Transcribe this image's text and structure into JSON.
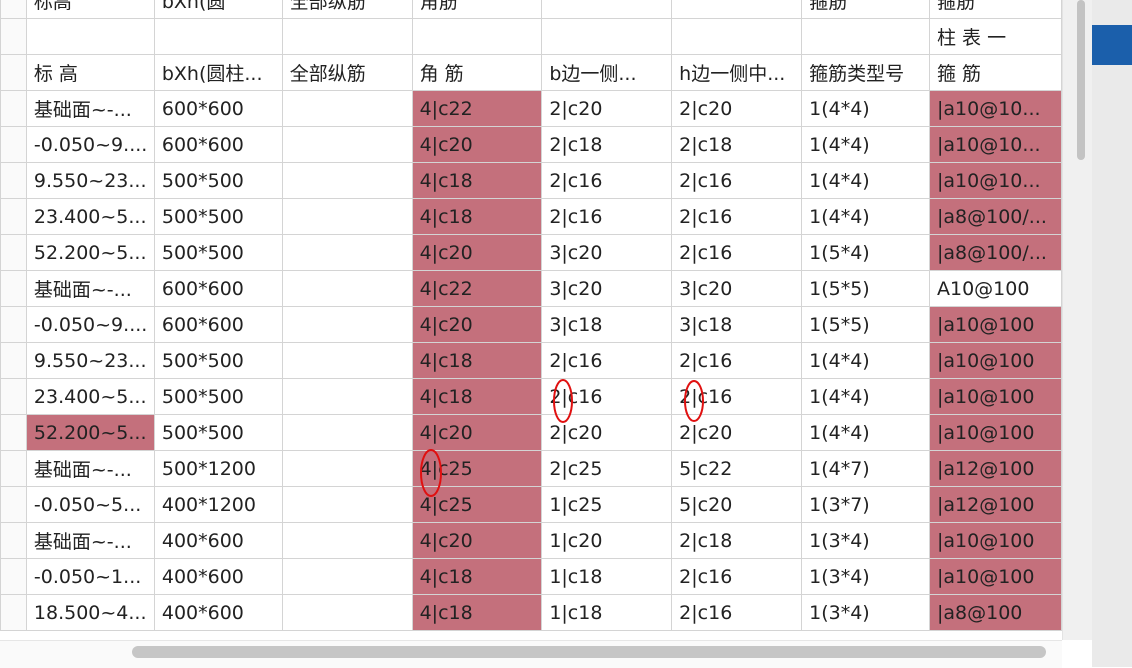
{
  "top_partial": [
    "标高",
    "bXh(圆",
    "全部纵筋",
    "角筋",
    "",
    "",
    "箍筋",
    "箍筋"
  ],
  "header_sub": [
    "",
    "",
    "",
    "",
    "",
    "",
    "",
    "柱 表 一"
  ],
  "headers": [
    "标  高",
    "bXh(圆柱...",
    "全部纵筋",
    "角 筋",
    "b边一侧...",
    "h边一侧中...",
    "箍筋类型号",
    "箍 筋"
  ],
  "rows": [
    {
      "cells": [
        "基础面~-...",
        "600*600",
        "",
        "4|c22",
        "2|c20",
        "2|c20",
        "1(4*4)",
        "|a10@10..."
      ],
      "hl": [
        3,
        7
      ]
    },
    {
      "cells": [
        "-0.050~9....",
        "600*600",
        "",
        "4|c20",
        "2|c18",
        "2|c18",
        "1(4*4)",
        "|a10@10..."
      ],
      "hl": [
        3,
        7
      ]
    },
    {
      "cells": [
        "9.550~23...",
        "500*500",
        "",
        "4|c18",
        "2|c16",
        "2|c16",
        "1(4*4)",
        "|a10@10..."
      ],
      "hl": [
        3,
        7
      ]
    },
    {
      "cells": [
        "23.400~5...",
        "500*500",
        "",
        "4|c18",
        "2|c16",
        "2|c16",
        "1(4*4)",
        "|a8@100/..."
      ],
      "hl": [
        3,
        7
      ]
    },
    {
      "cells": [
        "52.200~5...",
        "500*500",
        "",
        "4|c20",
        "3|c20",
        "2|c16",
        "1(5*4)",
        "|a8@100/..."
      ],
      "hl": [
        3,
        7
      ]
    },
    {
      "cells": [
        "基础面~-...",
        "600*600",
        "",
        "4|c22",
        "3|c20",
        "3|c20",
        "1(5*5)",
        "A10@100"
      ],
      "hl": [
        3
      ]
    },
    {
      "cells": [
        "-0.050~9....",
        "600*600",
        "",
        "4|c20",
        "3|c18",
        "3|c18",
        "1(5*5)",
        "|a10@100"
      ],
      "hl": [
        3,
        7
      ]
    },
    {
      "cells": [
        "9.550~23...",
        "500*500",
        "",
        "4|c18",
        "2|c16",
        "2|c16",
        "1(4*4)",
        "|a10@100"
      ],
      "hl": [
        3,
        7
      ]
    },
    {
      "cells": [
        "23.400~5...",
        "500*500",
        "",
        "4|c18",
        "2|c16",
        "2|c16",
        "1(4*4)",
        "|a10@100"
      ],
      "hl": [
        3,
        7
      ]
    },
    {
      "cells": [
        "52.200~5...",
        "500*500",
        "",
        "4|c20",
        "2|c20",
        "2|c20",
        "1(4*4)",
        "|a10@100"
      ],
      "hl": [
        0,
        3,
        7
      ]
    },
    {
      "cells": [
        "基础面~-...",
        "500*1200",
        "",
        "4|c25",
        "2|c25",
        "5|c22",
        "1(4*7)",
        "|a12@100"
      ],
      "hl": [
        3,
        7
      ]
    },
    {
      "cells": [
        "-0.050~5...",
        "400*1200",
        "",
        "4|c25",
        "1|c25",
        "5|c20",
        "1(3*7)",
        "|a12@100"
      ],
      "hl": [
        3,
        7
      ]
    },
    {
      "cells": [
        "基础面~-...",
        "400*600",
        "",
        "4|c20",
        "1|c20",
        "2|c18",
        "1(3*4)",
        "|a10@100"
      ],
      "hl": [
        3,
        7
      ]
    },
    {
      "cells": [
        "-0.050~1...",
        "400*600",
        "",
        "4|c18",
        "1|c18",
        "2|c16",
        "1(3*4)",
        "|a10@100"
      ],
      "hl": [
        3,
        7
      ]
    },
    {
      "cells": [
        "18.500~4...",
        "400*600",
        "",
        "4|c18",
        "1|c18",
        "2|c16",
        "1(3*4)",
        "|a8@100"
      ],
      "hl": [
        3,
        7
      ]
    }
  ],
  "colors": {
    "highlight": "#c4707c",
    "annotation": "#e01010",
    "accent": "#1b5fab"
  }
}
